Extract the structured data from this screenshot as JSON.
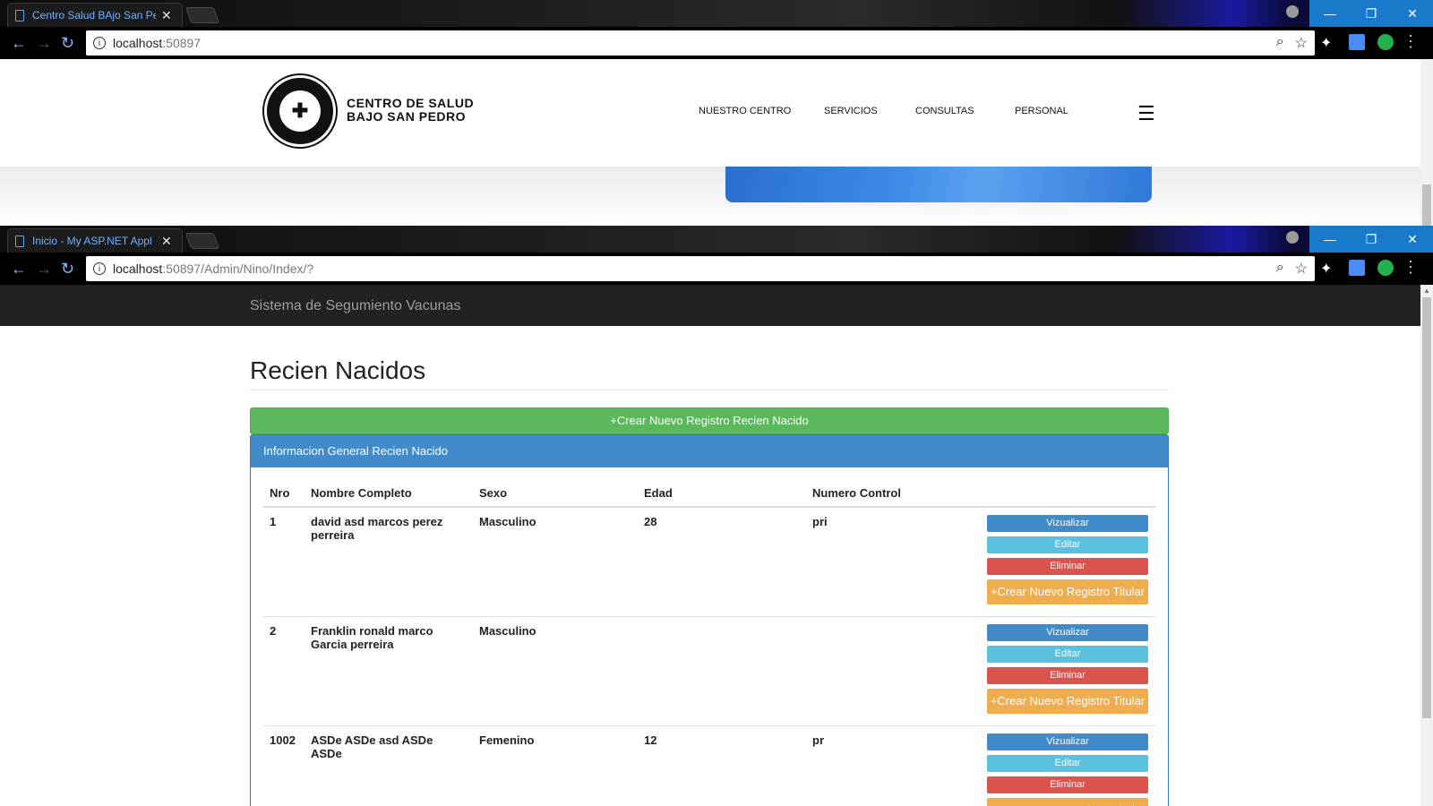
{
  "window1": {
    "tab_title": "Centro Salud BAjo San Pe",
    "url_host": "localhost",
    "url_path": ":50897",
    "site": {
      "brand_line1": "CENTRO DE SALUD",
      "brand_line2": "BAJO SAN PEDRO",
      "nav": [
        "NUESTRO CENTRO",
        "SERVICIOS",
        "CONSULTAS",
        "PERSONAL"
      ]
    }
  },
  "window2": {
    "tab_title": "Inicio - My ASP.NET Appl",
    "url_host": "localhost",
    "url_path": ":50897/Admin/Nino/Index/?",
    "app_title": "Sistema de Segumiento Vacunas",
    "page_title": "Recien Nacidos",
    "create_button": "+Crear Nuevo Registro Recien Nacido",
    "panel_title": "Informacion General Recien Nacido",
    "columns": [
      "Nro",
      "Nombre Completo",
      "Sexo",
      "Edad",
      "Numero Control"
    ],
    "actions": {
      "view": "Vizualizar",
      "edit": "Editar",
      "delete": "Eliminar",
      "titular": "+Crear Nuevo Registro Titular"
    },
    "rows": [
      {
        "nro": "1",
        "nombre": "david asd marcos perez perreira",
        "sexo": "Masculino",
        "edad": "28",
        "control": "pri"
      },
      {
        "nro": "2",
        "nombre": "Franklin ronald marco Garcia perreira",
        "sexo": "Masculino",
        "edad": "",
        "control": ""
      },
      {
        "nro": "1002",
        "nombre": "ASDe ASDe asd ASDe ASDe",
        "sexo": "Femenino",
        "edad": "12",
        "control": "pr"
      }
    ]
  },
  "colors": {
    "accent_blue": "#428bca",
    "success_green": "#5cb85c",
    "info_cyan": "#5bc0de",
    "danger_red": "#d9534f",
    "warning_orange": "#f0ad4e",
    "navbar_dark": "#222222"
  }
}
